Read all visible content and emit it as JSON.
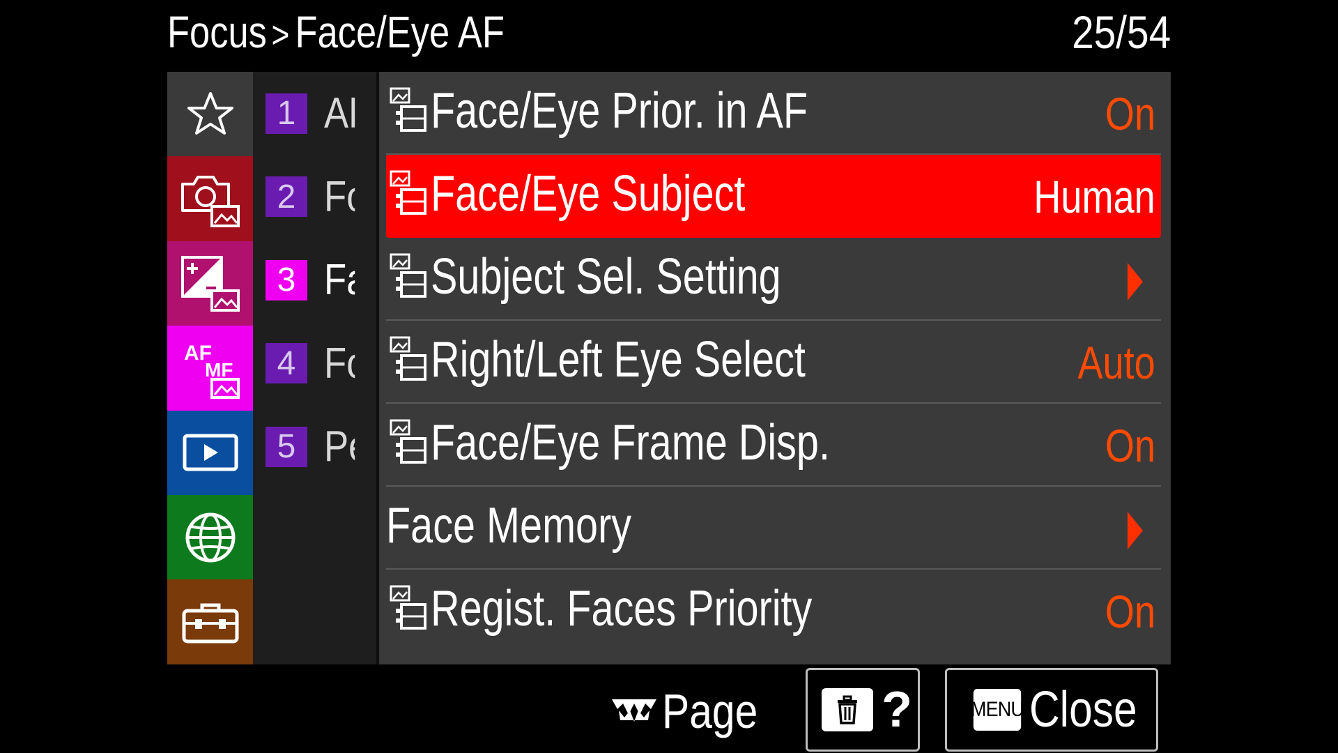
{
  "header": {
    "breadcrumb_parent": "Focus",
    "breadcrumb_separator": ">",
    "breadcrumb_current": "Face/Eye AF",
    "page_counter": "25/54"
  },
  "tabs": [
    {
      "icon": "star-icon",
      "color": "#3a3a3a"
    },
    {
      "icon": "camera-photo-icon",
      "color": "#a0101c"
    },
    {
      "icon": "exposure-color-icon",
      "color": "#b0106e"
    },
    {
      "icon": "af-mf-icon",
      "color": "#f000f0"
    },
    {
      "icon": "playback-icon",
      "color": "#0a4ea0"
    },
    {
      "icon": "network-globe-icon",
      "color": "#0e7a1e"
    },
    {
      "icon": "toolbox-icon",
      "color": "#7a3a0a"
    }
  ],
  "subpages": [
    {
      "num": "1",
      "label": "AF"
    },
    {
      "num": "2",
      "label": "Fo"
    },
    {
      "num": "3",
      "label": "Fa"
    },
    {
      "num": "4",
      "label": "Fo"
    },
    {
      "num": "5",
      "label": "Pe"
    }
  ],
  "menu_items": [
    {
      "label": "Face/Eye Prior. in AF",
      "value": "On"
    },
    {
      "label": "Face/Eye Subject",
      "value": "Human"
    },
    {
      "label": "Subject Sel. Setting",
      "value": ""
    },
    {
      "label": "Right/Left Eye Select",
      "value": "Auto"
    },
    {
      "label": "Face/Eye Frame Disp.",
      "value": "On"
    },
    {
      "label": "Face Memory",
      "value": ""
    },
    {
      "label": "Regist. Faces Priority",
      "value": "On"
    }
  ],
  "footer": {
    "page_label": "Page",
    "help_label": "?",
    "menu_key_label": "MENU",
    "close_label": "Close"
  },
  "colors": {
    "selection": "#ff0000",
    "value": "#ff4a00",
    "active_subpage": "#f000f0",
    "subpage_number": "#6a1bb0"
  }
}
